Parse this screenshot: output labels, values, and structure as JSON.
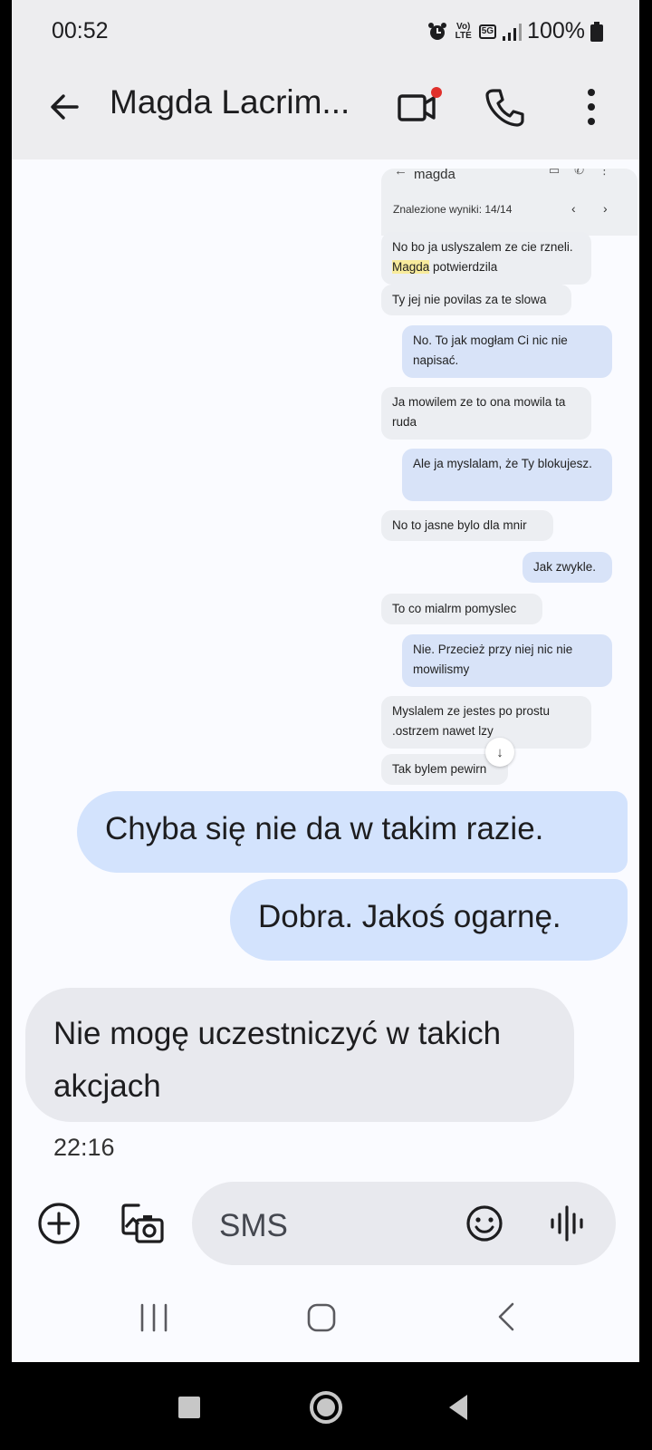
{
  "status_bar": {
    "time": "00:52",
    "battery": "100%",
    "network_badge_1": "Vo) LTE",
    "network_badge_2": "5G",
    "icons": [
      "alarm-icon",
      "volte-icon",
      "5g-icon",
      "signal-icon",
      "battery-icon"
    ]
  },
  "app_bar": {
    "title": "Magda Lacrim...",
    "icons": [
      "back-arrow-icon",
      "video-call-icon",
      "phone-icon",
      "more-vert-icon"
    ],
    "video_badge_color": "#e0302b"
  },
  "embedded_screenshot": {
    "contact": "magda",
    "search_results": "Znalezione wyniki: 14/14",
    "messages": [
      {
        "dir": "in",
        "pre": "No bo ja uslyszalem ze cie rzneli. ",
        "highlight": "Magda",
        "post": " potwierdzila"
      },
      {
        "dir": "in",
        "text": "Ty jej nie povilas za te slowa"
      },
      {
        "dir": "out",
        "text": "No. To jak mogłam Ci nic nie napisać."
      },
      {
        "dir": "in",
        "text": "Ja mowilem ze to ona mowila ta ruda"
      },
      {
        "dir": "out",
        "text": "Ale ja myslalam, że Ty blokujesz."
      },
      {
        "dir": "in",
        "text": "No to jasne bylo dla mnir"
      },
      {
        "dir": "out",
        "text": "Jak zwykle."
      },
      {
        "dir": "in",
        "text": "To co mialrm pomyslec"
      },
      {
        "dir": "out",
        "text": "Nie. Przecież przy niej nic nie mowilismy"
      },
      {
        "dir": "in",
        "text": "Myslalem ze jestes po prostu .ostrzem nawet lzy"
      },
      {
        "dir": "in",
        "text": "Tak bylem pewirn"
      }
    ]
  },
  "conversation": {
    "messages": [
      {
        "dir": "out",
        "text": "Chyba się nie da w takim razie."
      },
      {
        "dir": "out",
        "text": "Dobra. Jakoś ogarnę."
      },
      {
        "dir": "in",
        "text": "Nie mogę uczestniczyć w takich akcjach"
      }
    ],
    "timestamp": "22:16"
  },
  "input": {
    "placeholder": "SMS",
    "icons": [
      "add-circle-icon",
      "gallery-icon",
      "emoji-icon",
      "voice-icon"
    ]
  },
  "colors": {
    "outgoing_bubble": "#d3e3fd",
    "incoming_bubble": "#e8e9ee",
    "app_bar": "#ededef",
    "search_highlight": "#f8eb9c"
  }
}
